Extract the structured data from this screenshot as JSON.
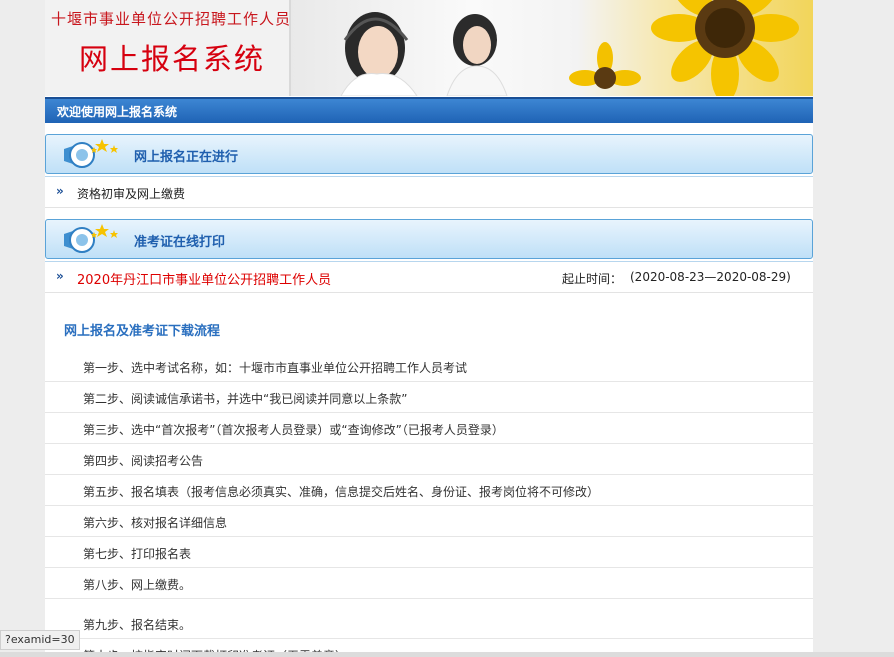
{
  "banner": {
    "line1": "十堰市事业单位公开招聘工作人员",
    "line2": "网上报名系统"
  },
  "welcome": "欢迎使用网上报名系统",
  "sections": [
    {
      "title": "网上报名正在进行",
      "items": [
        {
          "text": "资格初审及网上缴费"
        }
      ]
    },
    {
      "title": "准考证在线打印",
      "items": [
        {
          "text": "2020年丹江口市事业单位公开招聘工作人员",
          "time_label": "起止时间：",
          "time_value": "(2020-08-23—2020-08-29)"
        }
      ]
    }
  ],
  "flow": {
    "title": "网上报名及准考证下载流程",
    "steps": [
      "第一步、选中考试名称，如：十堰市市直事业单位公开招聘工作人员考试",
      "第二步、阅读诚信承诺书，并选中“我已阅读并同意以上条款”",
      "第三步、选中“首次报考”（首次报考人员登录）或“查询修改”（已报考人员登录）",
      "第四步、阅读招考公告",
      "第五步、报名填表（报考信息必须真实、准确，信息提交后姓名、身份证、报考岗位将不可修改）",
      "第六步、核对报名详细信息",
      "第七步、打印报名表",
      "第八步、网上缴费。",
      "第九步、报名结束。",
      "第十步、按指定时间下载打印准考证（无需盖章）"
    ]
  },
  "status_url": "?examid=30",
  "colors": {
    "accent": "#1f63b5",
    "title_red": "#d6000f",
    "header_blue": "#1f5fae"
  }
}
